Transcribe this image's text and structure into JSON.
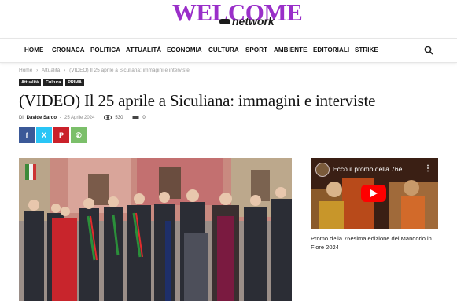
{
  "logo": {
    "main": "WELCOME",
    "sub": "network"
  },
  "nav": {
    "items": [
      "HOME",
      "CRONACA",
      "POLITICA",
      "ATTUALITÀ",
      "ECONOMIA",
      "CULTURA",
      "SPORT",
      "AMBIENTE",
      "EDITORIALI",
      "STRIKE"
    ],
    "search_icon": "search-icon"
  },
  "breadcrumb": {
    "home": "Home",
    "sep": "›",
    "section": "Attualità",
    "current": "(VIDEO) Il 25 aprile a Siculiana: immagini e interviste"
  },
  "tags": [
    "Attualità",
    "Cultura",
    "PRIMA"
  ],
  "article": {
    "title": "(VIDEO) Il 25 aprile a Siculiana: immagini e interviste",
    "by": "Di",
    "author": "Davide Sardo",
    "dash": "-",
    "date": "25 Aprile 2024",
    "views": "530",
    "comments": "0"
  },
  "share": [
    {
      "name": "facebook",
      "glyph": "f",
      "color": "#3b5998"
    },
    {
      "name": "twitter",
      "glyph": "X",
      "color": "#29c5f6"
    },
    {
      "name": "pinterest",
      "glyph": "P",
      "color": "#ca212a"
    },
    {
      "name": "whatsapp",
      "glyph": "✆",
      "color": "#7bbf6a"
    }
  ],
  "sidebar": {
    "video_title": "Ecco il promo della 76e...",
    "caption": "Promo della 76esima edizione del Mandorlo in Fiore 2024"
  }
}
